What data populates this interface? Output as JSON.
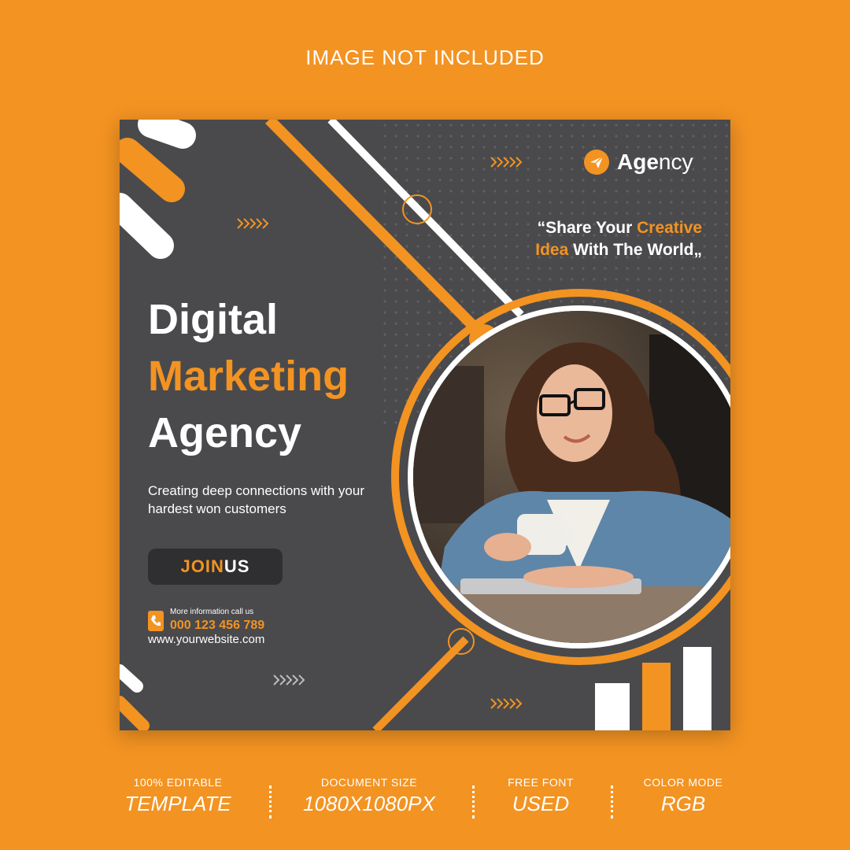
{
  "top_note": "IMAGE NOT INCLUDED",
  "logo": {
    "text_bold": "Age",
    "text_light": "ncy",
    "icon": "paper-plane-icon"
  },
  "quote": {
    "line1_a": "“Share Your ",
    "line1_b": "Creative",
    "line2_a": "Idea",
    "line2_b": " With The World„"
  },
  "headline": {
    "line1": "Digital",
    "line2": "Marketing",
    "line3": "Agency"
  },
  "subline": "Creating deep connections with your hardest won customers",
  "cta": {
    "label_a": "JOIN",
    "label_b": " US"
  },
  "contact": {
    "label": "More information call us",
    "phone": "000 123 456 789",
    "website": "www.yourwebsite.com"
  },
  "features": [
    {
      "small": "100% EDITABLE",
      "big": "TEMPLATE"
    },
    {
      "small": "DOCUMENT SIZE",
      "big": "1080X1080PX"
    },
    {
      "small": "FREE FONT",
      "big": "USED"
    },
    {
      "small": "COLOR MODE",
      "big": "RGB"
    }
  ],
  "colors": {
    "orange": "#f39322",
    "dark": "#4a4a4c",
    "button": "#2f2f31",
    "white": "#ffffff"
  }
}
